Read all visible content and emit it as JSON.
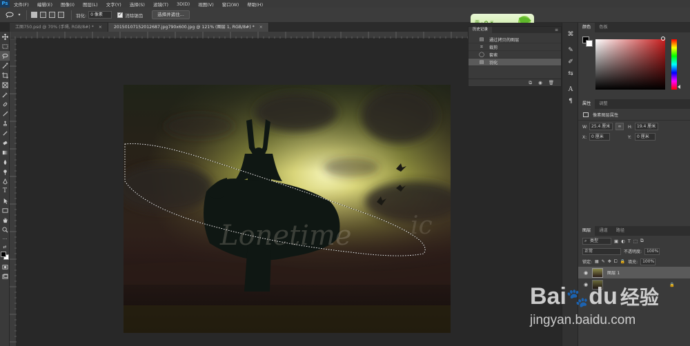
{
  "menu": [
    "文件(F)",
    "编辑(E)",
    "图像(I)",
    "图层(L)",
    "文字(Y)",
    "选择(S)",
    "滤镜(T)",
    "3D(D)",
    "视图(V)",
    "窗口(W)",
    "帮助(H)"
  ],
  "app_logo": "Ps",
  "options": {
    "feather_label": "羽化:",
    "feather_value": "0 像素",
    "antialias_label": "消除锯齿",
    "select_mask_button": "选择并遮住..."
  },
  "tabs": [
    {
      "label": "工图750.psd @ 70% (手绳, RGB/8#) *",
      "active": false
    },
    {
      "label": "20150107152012687.jpg790x600.jpg @ 121% (图层 1, RGB/8#) *",
      "active": true
    }
  ],
  "history": {
    "tab_label": "历史记录",
    "items": [
      {
        "label": "通过拷贝的图层",
        "icon": "doc-icon"
      },
      {
        "label": "裁剪",
        "icon": "crop-icon"
      },
      {
        "label": "套索",
        "icon": "lasso-icon"
      },
      {
        "label": "羽化",
        "icon": "doc-icon"
      }
    ]
  },
  "color_panel": {
    "tabs": [
      "颜色",
      "色板"
    ],
    "accent": "#c81e1e"
  },
  "properties_panel": {
    "tabs": [
      "属性",
      "调整"
    ],
    "title": "像素图层属性",
    "w_label": "W:",
    "w_value": "25.4 厘米",
    "h_label": "H:",
    "h_value": "19.4 厘米",
    "x_label": "X:",
    "x_value": "0 厘米",
    "y_label": "Y:",
    "y_value": "0 厘米",
    "link_glyph": "∞"
  },
  "layers_panel": {
    "tabs": [
      "图层",
      "通道",
      "路径"
    ],
    "filter_kind": "类型",
    "blend_mode": "正常",
    "opacity_label": "不透明度:",
    "opacity_value": "100%",
    "lock_label": "锁定:",
    "fill_label": "填充:",
    "fill_value": "100%",
    "layers": [
      {
        "name": "图层 1",
        "selected": true
      }
    ]
  },
  "artwork": {
    "watermark_text": "Lonetime",
    "watermark_tail": "ic"
  },
  "baidu_watermark": {
    "brand": "Bai",
    "paw": "du",
    "brand_cn": "经验",
    "url": "jingyan.baidu.com"
  }
}
